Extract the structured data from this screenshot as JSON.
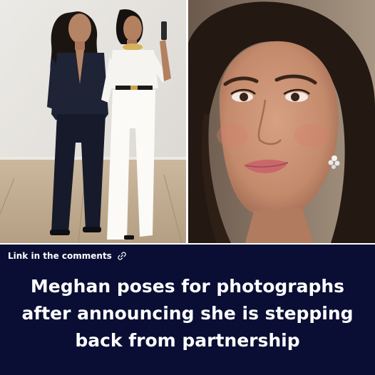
{
  "post": {
    "link_label": "Link in the comments",
    "link_icon": "link-icon",
    "headline": "Meghan poses for photographs after announcing she is stepping back from partnership",
    "colors": {
      "banner_background": "#0a0e34",
      "text": "#ffffff"
    }
  }
}
